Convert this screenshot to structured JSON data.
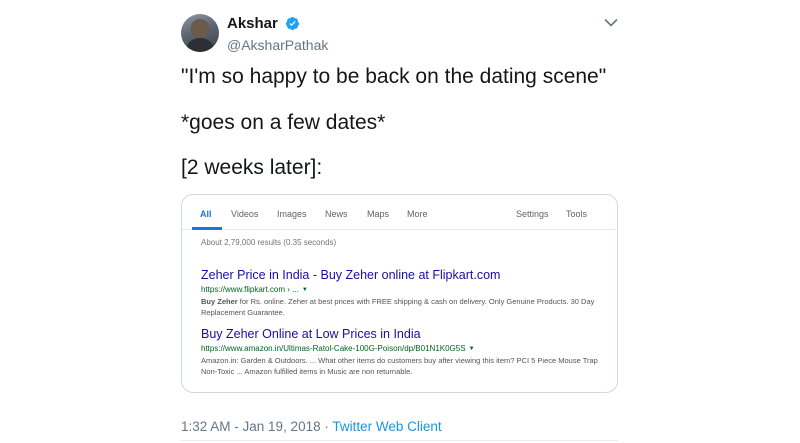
{
  "author": {
    "display_name": "Akshar",
    "handle": "@AksharPathak",
    "verified": true
  },
  "tweet": {
    "lines": [
      "\"I'm so happy to be back on the dating scene\"",
      "*goes on a few dates*",
      "[2 weeks later]:"
    ]
  },
  "search_screenshot": {
    "tabs": [
      "All",
      "Videos",
      "Images",
      "News",
      "Maps",
      "More"
    ],
    "right_tabs": [
      "Settings",
      "Tools"
    ],
    "active_tab": "All",
    "stats": "About 2,79,000 results (0.35 seconds)",
    "results": [
      {
        "title": "Zeher Price in India - Buy Zeher online at Flipkart.com",
        "url": "https://www.flipkart.com › ...",
        "snippet_bold": "Buy Zeher",
        "snippet_rest": " for Rs. online. Zeher at best prices with FREE shipping & cash on delivery. Only Genuine Products. 30 Day Replacement Guarantee."
      },
      {
        "title": "Buy Zeher Online at Low Prices in India",
        "url": "https://www.amazon.in/Ultimas-Ratol-Cake-100G-Poison/dp/B01N1K0G5S",
        "snippet_bold": "",
        "snippet_rest": "Amazon.in: Garden & Outdoors. ... What other items do customers buy after viewing this item? PCI 5 Piece Mouse Trap Non-Toxic ... Amazon fulfilled items in Music are non returnable."
      }
    ]
  },
  "meta": {
    "timestamp": "1:32 AM - Jan 19, 2018",
    "separator": " · ",
    "client": "Twitter Web Client"
  },
  "colors": {
    "verified": "#1da1f2",
    "link_blue": "#1a0dab",
    "url_green": "#006621",
    "client_blue": "#1b95e0",
    "muted": "#657786"
  },
  "icons": [
    "verified-badge-icon",
    "chevron-down-icon",
    "dropdown-caret-icon"
  ]
}
